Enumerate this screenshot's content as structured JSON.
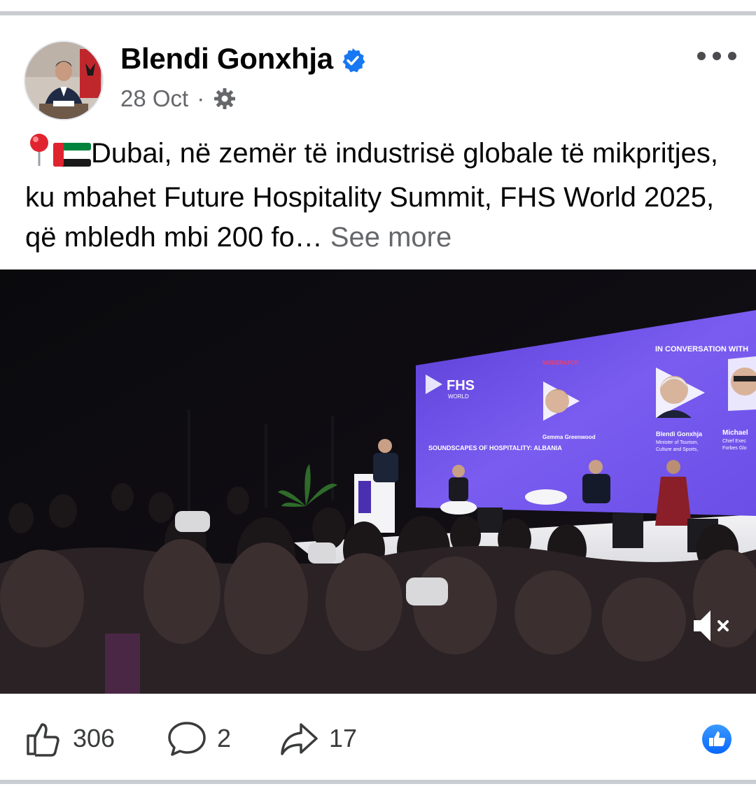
{
  "post": {
    "author_name": "Blendi Gonxhja",
    "date": "28 Oct",
    "separator": "·",
    "text": "Dubai, në zemër të industrisë globale të mikpritjes, ku mbahet Future Hospitality Summit, FHS World 2025, që mbledh mbi 200 fo…",
    "see_more": "See more",
    "leading_icons": [
      "round-pushpin-icon",
      "uae-flag-icon"
    ]
  },
  "media": {
    "screen_logo": "FHS",
    "screen_logo_sub": "WORLD",
    "screen_session": "SOUNDSCAPES OF HOSPITALITY: ALBANIA",
    "screen_moderator_label": "MODERATOR",
    "screen_conversation_label": "IN CONVERSATION WITH",
    "screen_speaker_1_name": "Gemma Greenwood",
    "screen_speaker_2_name": "Blendi Gonxhja",
    "screen_speaker_2_title_1": "Minister of Tourism,",
    "screen_speaker_2_title_2": "Culture and Sports,",
    "screen_speaker_3_name": "Michael",
    "screen_speaker_3_title_1": "Chief Exec",
    "screen_speaker_3_title_2": "Forbes Glo",
    "mute_icon": "speaker-muted-icon"
  },
  "actions": {
    "like_count": "306",
    "comment_count": "2",
    "share_count": "17"
  },
  "colors": {
    "verified": "#1877f2",
    "text_primary": "#050505",
    "text_secondary": "#65676b",
    "divider": "#c9ccd1",
    "screen_purple": "#6b4fe0"
  }
}
